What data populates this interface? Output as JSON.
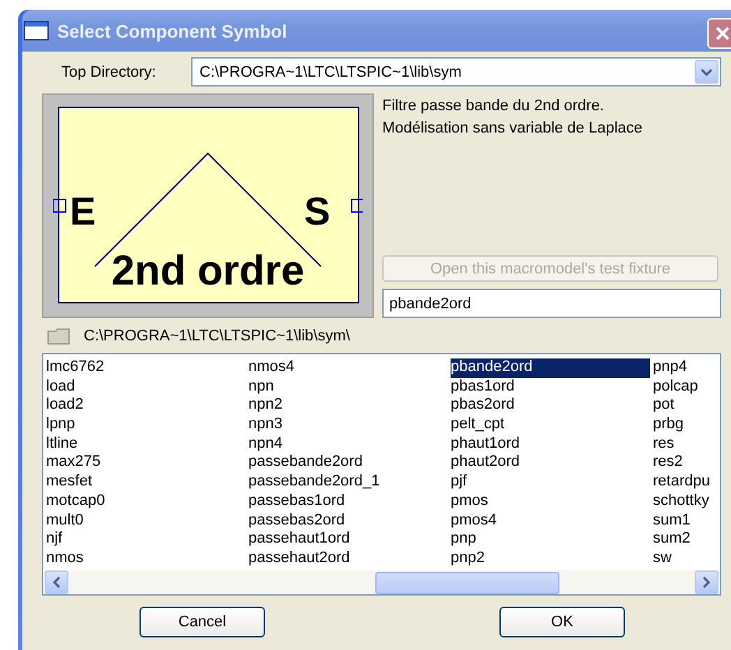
{
  "window": {
    "title": "Select Component Symbol"
  },
  "top_directory": {
    "label": "Top Directory:",
    "value": "C:\\PROGRA~1\\LTC\\LTSPIC~1\\lib\\sym"
  },
  "symbol_preview": {
    "input_label": "E",
    "output_label": "S",
    "caption": "2nd ordre"
  },
  "description": [
    "Filtre passe bande du 2nd ordre.",
    "Modélisation sans variable de Laplace"
  ],
  "test_fixture_button": {
    "label": "Open this macromodel's test fixture",
    "disabled": true
  },
  "symbol_name": {
    "value": "pbande2ord"
  },
  "current_path": "C:\\PROGRA~1\\LTC\\LTSPIC~1\\lib\\sym\\",
  "list": {
    "columns": [
      [
        {
          "label": "lmc6762",
          "selected": false
        },
        {
          "label": "load",
          "selected": false
        },
        {
          "label": "load2",
          "selected": false
        },
        {
          "label": "lpnp",
          "selected": false
        },
        {
          "label": "ltline",
          "selected": false
        },
        {
          "label": "max275",
          "selected": false
        },
        {
          "label": "mesfet",
          "selected": false
        },
        {
          "label": "motcap0",
          "selected": false
        },
        {
          "label": "mult0",
          "selected": false
        },
        {
          "label": "njf",
          "selected": false
        },
        {
          "label": "nmos",
          "selected": false
        }
      ],
      [
        {
          "label": "nmos4",
          "selected": false
        },
        {
          "label": "npn",
          "selected": false
        },
        {
          "label": "npn2",
          "selected": false
        },
        {
          "label": "npn3",
          "selected": false
        },
        {
          "label": "npn4",
          "selected": false
        },
        {
          "label": "passebande2ord",
          "selected": false
        },
        {
          "label": "passebande2ord_1",
          "selected": false
        },
        {
          "label": "passebas1ord",
          "selected": false
        },
        {
          "label": "passebas2ord",
          "selected": false
        },
        {
          "label": "passehaut1ord",
          "selected": false
        },
        {
          "label": "passehaut2ord",
          "selected": false
        }
      ],
      [
        {
          "label": "pbande2ord",
          "selected": true
        },
        {
          "label": "pbas1ord",
          "selected": false
        },
        {
          "label": "pbas2ord",
          "selected": false
        },
        {
          "label": "pelt_cpt",
          "selected": false
        },
        {
          "label": "phaut1ord",
          "selected": false
        },
        {
          "label": "phaut2ord",
          "selected": false
        },
        {
          "label": "pjf",
          "selected": false
        },
        {
          "label": "pmos",
          "selected": false
        },
        {
          "label": "pmos4",
          "selected": false
        },
        {
          "label": "pnp",
          "selected": false
        },
        {
          "label": "pnp2",
          "selected": false
        }
      ],
      [
        {
          "label": "pnp4",
          "selected": false
        },
        {
          "label": "polcap",
          "selected": false
        },
        {
          "label": "pot",
          "selected": false
        },
        {
          "label": "prbg",
          "selected": false
        },
        {
          "label": "res",
          "selected": false
        },
        {
          "label": "res2",
          "selected": false
        },
        {
          "label": "retardpu",
          "selected": false
        },
        {
          "label": "schottky",
          "selected": false
        },
        {
          "label": "sum1",
          "selected": false
        },
        {
          "label": "sum2",
          "selected": false
        },
        {
          "label": "sw",
          "selected": false
        }
      ]
    ]
  },
  "buttons": [
    {
      "label": "Cancel"
    },
    {
      "label": "OK"
    }
  ]
}
